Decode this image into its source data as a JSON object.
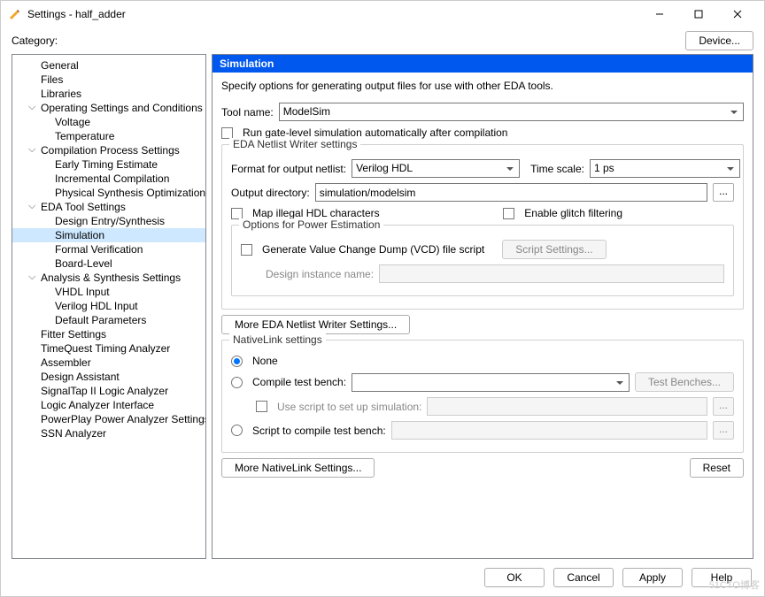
{
  "window": {
    "title": "Settings - half_adder"
  },
  "toprow": {
    "category": "Category:",
    "device_btn": "Device..."
  },
  "tree": [
    {
      "lvl": 1,
      "exp": false,
      "label": "General"
    },
    {
      "lvl": 1,
      "exp": false,
      "label": "Files"
    },
    {
      "lvl": 1,
      "exp": false,
      "label": "Libraries"
    },
    {
      "lvl": 1,
      "exp": true,
      "label": "Operating Settings and Conditions"
    },
    {
      "lvl": 2,
      "exp": false,
      "label": "Voltage"
    },
    {
      "lvl": 2,
      "exp": false,
      "label": "Temperature"
    },
    {
      "lvl": 1,
      "exp": true,
      "label": "Compilation Process Settings"
    },
    {
      "lvl": 2,
      "exp": false,
      "label": "Early Timing Estimate"
    },
    {
      "lvl": 2,
      "exp": false,
      "label": "Incremental Compilation"
    },
    {
      "lvl": 2,
      "exp": false,
      "label": "Physical Synthesis Optimizations"
    },
    {
      "lvl": 1,
      "exp": true,
      "label": "EDA Tool Settings"
    },
    {
      "lvl": 2,
      "exp": false,
      "label": "Design Entry/Synthesis"
    },
    {
      "lvl": 2,
      "exp": false,
      "label": "Simulation",
      "sel": true
    },
    {
      "lvl": 2,
      "exp": false,
      "label": "Formal Verification"
    },
    {
      "lvl": 2,
      "exp": false,
      "label": "Board-Level"
    },
    {
      "lvl": 1,
      "exp": true,
      "label": "Analysis & Synthesis Settings"
    },
    {
      "lvl": 2,
      "exp": false,
      "label": "VHDL Input"
    },
    {
      "lvl": 2,
      "exp": false,
      "label": "Verilog HDL Input"
    },
    {
      "lvl": 2,
      "exp": false,
      "label": "Default Parameters"
    },
    {
      "lvl": 1,
      "exp": false,
      "label": "Fitter Settings"
    },
    {
      "lvl": 1,
      "exp": false,
      "label": "TimeQuest Timing Analyzer"
    },
    {
      "lvl": 1,
      "exp": false,
      "label": "Assembler"
    },
    {
      "lvl": 1,
      "exp": false,
      "label": "Design Assistant"
    },
    {
      "lvl": 1,
      "exp": false,
      "label": "SignalTap II Logic Analyzer"
    },
    {
      "lvl": 1,
      "exp": false,
      "label": "Logic Analyzer Interface"
    },
    {
      "lvl": 1,
      "exp": false,
      "label": "PowerPlay Power Analyzer Settings"
    },
    {
      "lvl": 1,
      "exp": false,
      "label": "SSN Analyzer"
    }
  ],
  "panel": {
    "header": "Simulation",
    "desc": "Specify options for generating output files for use with other EDA tools.",
    "tool_name_lbl": "Tool name:",
    "tool_name_val": "ModelSim",
    "run_gate": "Run gate-level simulation automatically after compilation",
    "netlist_group": "EDA Netlist Writer settings",
    "format_lbl": "Format for output netlist:",
    "format_val": "Verilog HDL",
    "timescale_lbl": "Time scale:",
    "timescale_val": "1 ps",
    "outdir_lbl": "Output directory:",
    "outdir_val": "simulation/modelsim",
    "map_illegal": "Map illegal HDL characters",
    "glitch": "Enable glitch filtering",
    "power_group": "Options for Power Estimation",
    "vcd_chk": "Generate Value Change Dump (VCD) file script",
    "script_settings_btn": "Script Settings...",
    "design_inst_lbl": "Design instance name:",
    "more_netlist_btn": "More EDA Netlist Writer Settings...",
    "native_group": "NativeLink settings",
    "rad_none": "None",
    "rad_compile": "Compile test bench:",
    "test_benches_btn": "Test Benches...",
    "use_script_chk": "Use script to set up simulation:",
    "rad_script": "Script to compile test bench:",
    "more_native_btn": "More NativeLink Settings...",
    "reset_btn": "Reset"
  },
  "footer": {
    "ok": "OK",
    "cancel": "Cancel",
    "apply": "Apply",
    "help": "Help"
  },
  "watermark": "51CTO博客"
}
